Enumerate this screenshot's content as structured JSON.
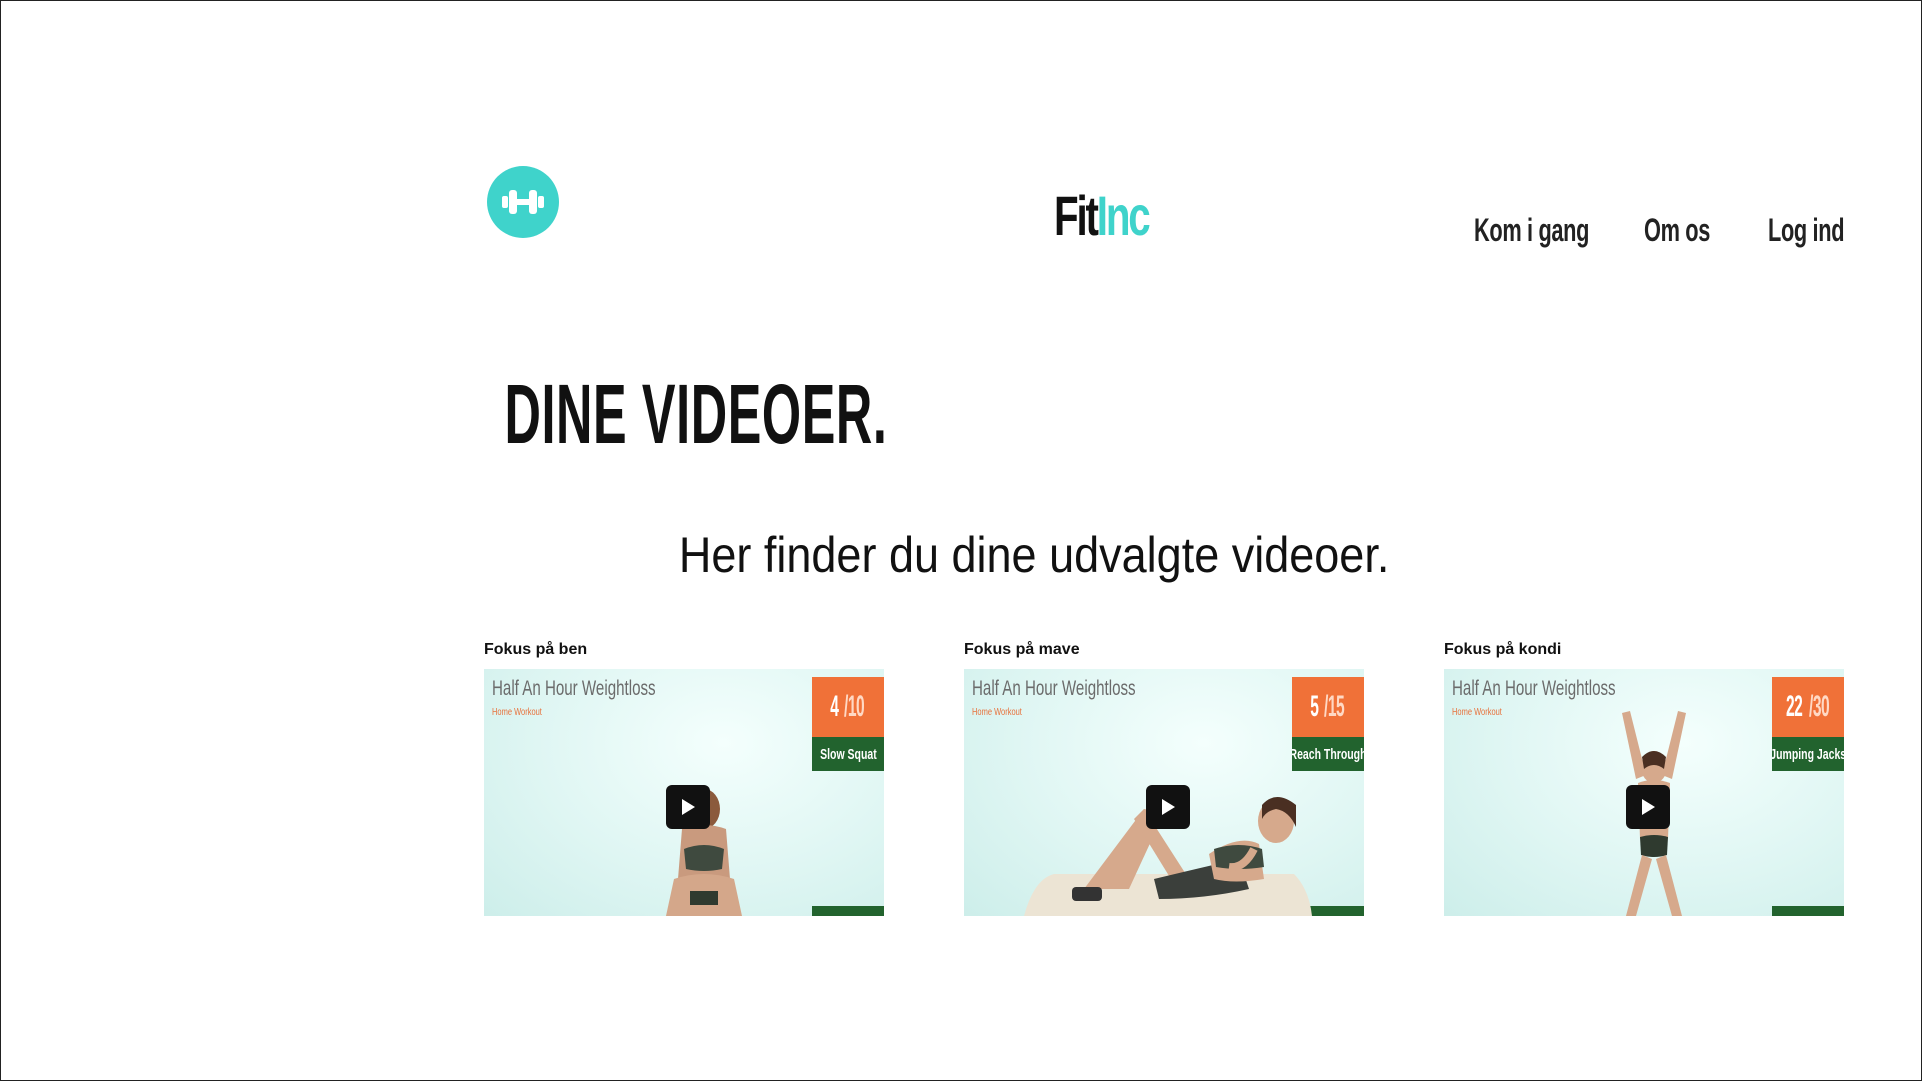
{
  "header": {
    "logo_icon": "dumbbell-icon",
    "brand_part1": "Fit",
    "brand_part2": "Inc",
    "brand_accent_color": "#3fd3cb"
  },
  "nav": {
    "items": [
      {
        "label": "Kom i gang"
      },
      {
        "label": "Om os"
      },
      {
        "label": "Log ind"
      }
    ]
  },
  "main": {
    "title": "DINE VIDEOER.",
    "subtitle": "Her finder du dine udvalgte videoer."
  },
  "videos": [
    {
      "label": "Fokus på ben",
      "thumb_title": "Half An Hour Weightloss",
      "thumb_subtitle": "Home Workout",
      "counter_current": "4",
      "counter_total": "/10",
      "exercise": "Slow Squat"
    },
    {
      "label": "Fokus på mave",
      "thumb_title": "Half An Hour Weightloss",
      "thumb_subtitle": "Home Workout",
      "counter_current": "5",
      "counter_total": "/15",
      "exercise": "Reach Through"
    },
    {
      "label": "Fokus på kondi",
      "thumb_title": "Half An Hour Weightloss",
      "thumb_subtitle": "Home Workout",
      "counter_current": "22",
      "counter_total": "/30",
      "exercise": "Jumping Jacks"
    }
  ]
}
